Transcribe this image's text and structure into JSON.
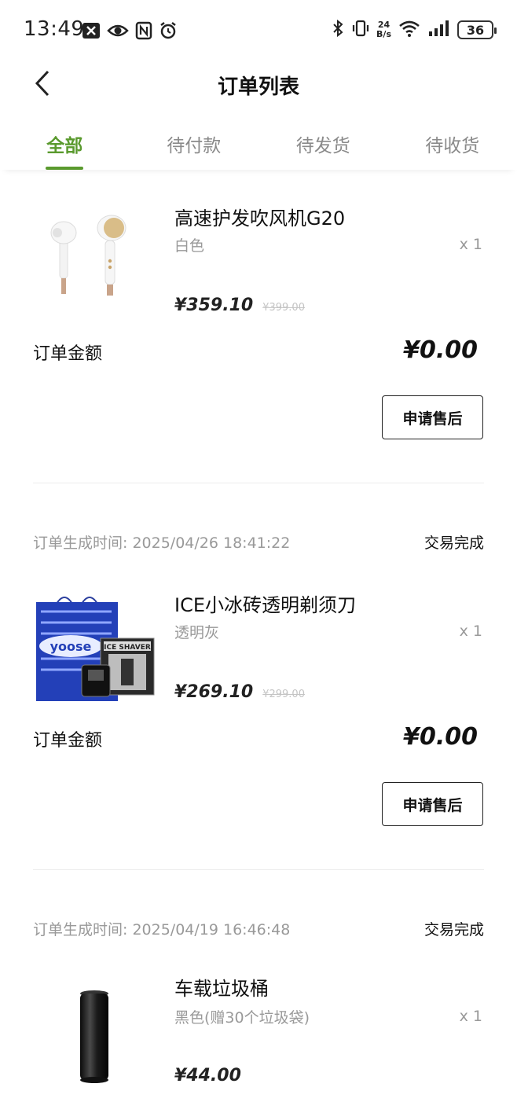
{
  "status_bar": {
    "time": "13:49",
    "net_speed_value": "24",
    "net_speed_unit": "B/s",
    "battery": "36",
    "left_icons": [
      "close-box-icon",
      "eye-icon",
      "nfc-icon",
      "alarm-icon"
    ],
    "right_icons": [
      "bluetooth-icon",
      "vibrate-icon",
      "wifi-icon",
      "signal-icon"
    ]
  },
  "nav": {
    "title": "订单列表",
    "back_icon": "chevron-left-icon"
  },
  "tabs": [
    {
      "label": "全部",
      "active": true
    },
    {
      "label": "待付款",
      "active": false
    },
    {
      "label": "待发货",
      "active": false
    },
    {
      "label": "待收货",
      "active": false
    }
  ],
  "colors": {
    "accent": "#5a9a2e",
    "muted_text": "#999999",
    "strike_price": "#c4c4c4"
  },
  "orders": [
    {
      "product": {
        "name": "高速护发吹风机G20",
        "spec": "白色",
        "qty": "x 1",
        "price": "¥359.10",
        "original_price": "¥399.00",
        "image_icon": "hair-dryer-icon"
      },
      "amount_label": "订单金额",
      "amount": "¥0.00",
      "action": "申请售后"
    },
    {
      "created_label": "订单生成时间:",
      "created_time": "2025/04/26 18:41:22",
      "status": "交易完成",
      "product": {
        "name": "ICE小冰砖透明剃须刀",
        "spec": "透明灰",
        "qty": "x 1",
        "price": "¥269.10",
        "original_price": "¥299.00",
        "image_icon": "shaver-box-icon",
        "image_text_1": "ICE SHAVER",
        "image_text_2": "yoose"
      },
      "amount_label": "订单金额",
      "amount": "¥0.00",
      "action": "申请售后"
    },
    {
      "created_label": "订单生成时间:",
      "created_time": "2025/04/19 16:46:48",
      "status": "交易完成",
      "product": {
        "name": "车载垃圾桶",
        "spec": "黑色(赠30个垃圾袋)",
        "qty": "x 1",
        "price": "¥44.00",
        "image_icon": "car-trash-can-icon"
      }
    }
  ]
}
